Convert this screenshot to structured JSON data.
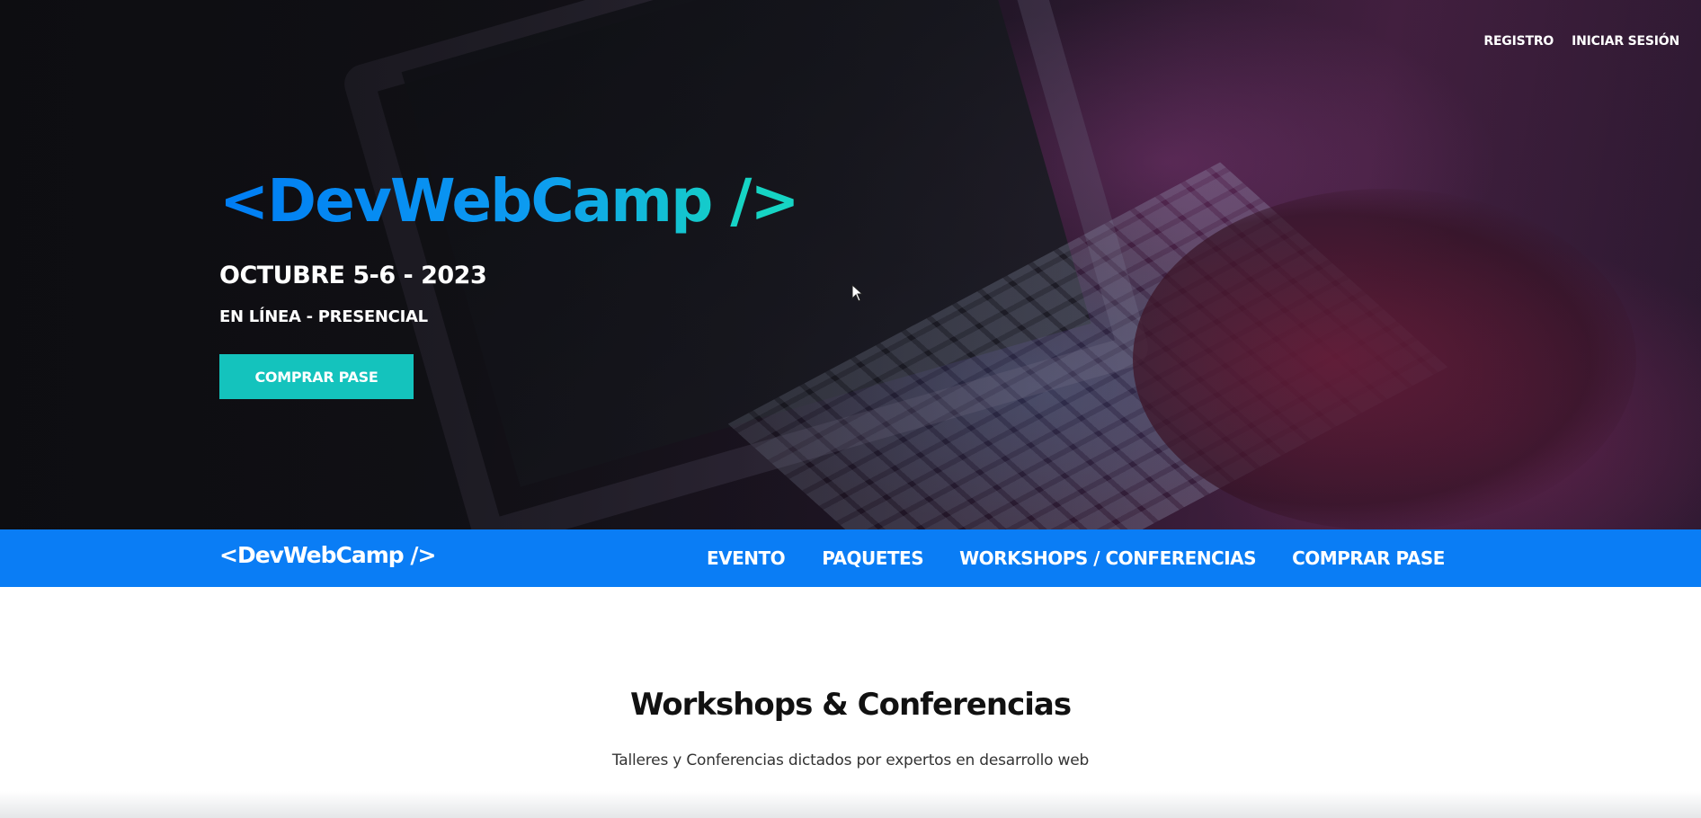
{
  "header": {
    "top_links": [
      "REGISTRO",
      "INICIAR SESIÓN"
    ]
  },
  "hero": {
    "logo": "<DevWebCamp />",
    "date": "OCTUBRE 5-6 - 2023",
    "mode": "EN LÍNEA - PRESENCIAL",
    "cta_label": "COMPRAR PASE"
  },
  "navbar": {
    "logo": "<DevWebCamp />",
    "links": [
      "EVENTO",
      "PAQUETES",
      "WORKSHOPS / CONFERENCIAS",
      "COMPRAR PASE"
    ]
  },
  "section": {
    "title": "Workshops & Conferencias",
    "subtitle": "Talleres y Conferencias dictados por expertos en desarrollo web"
  },
  "colors": {
    "nav_blue": "#0a7df5",
    "cta_teal": "#14c3bd",
    "logo_gradient_start": "#007df4",
    "logo_gradient_end": "#16d4c4"
  },
  "icons": {
    "pointer": "mouse-pointer-icon"
  }
}
